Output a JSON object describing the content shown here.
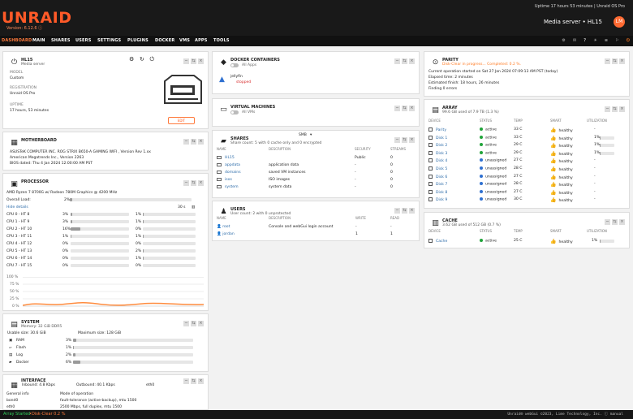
{
  "header": {
    "logo": "UNRAID",
    "version": "Version: 6.12.6 ⓘ",
    "uptime": "Uptime 17 hours 53 minutes  |  Unraid OS Pro",
    "server_title": "Media server  •  HL15",
    "avatar": "LM"
  },
  "nav": {
    "items": [
      "DASHBOARD",
      "MAIN",
      "SHARES",
      "USERS",
      "SETTINGS",
      "PLUGINS",
      "DOCKER",
      "VMS",
      "APPS",
      "TOOLS"
    ],
    "icons": [
      "⚙",
      "✉",
      "?",
      "☀",
      "≡",
      "⚐",
      "⏻"
    ]
  },
  "server": {
    "name": "HL15",
    "description": "Media server",
    "model_label": "MODEL",
    "model": "Custom",
    "registration_label": "REGISTRATION",
    "registration": "Unraid OS Pro",
    "uptime_label": "UPTIME",
    "uptime": "17 hours, 53 minutes",
    "edit_label": "EDIT"
  },
  "motherboard": {
    "title": "MOTHERBOARD",
    "line1": "ASUSTeK COMPUTER INC. ROG STRIX B650-A GAMING WIFI , Version Rev 1.xx",
    "line2": "American Megatrends Inc., Version 2263",
    "line3": "BIOS dated: Thu 4 Jan 2024 12:00:00 AM PST"
  },
  "processor": {
    "title": "PROCESSOR",
    "model": "AMD Ryzen 7 8700G w/ Radeon 780M Graphics @ 4200 MHz",
    "overall_label": "Overall Load:",
    "overall": "2%",
    "overall_value": 2,
    "hide": "Hide details",
    "interval": "30 s",
    "cpus": [
      {
        "name": "CPU 0 - HT 8",
        "a": "3%",
        "av": 3,
        "b": "1%",
        "bv": 1
      },
      {
        "name": "CPU 1 - HT 9",
        "a": "3%",
        "av": 3,
        "b": "1%",
        "bv": 1
      },
      {
        "name": "CPU 2 - HT 10",
        "a": "16%",
        "av": 16,
        "b": "0%",
        "bv": 0
      },
      {
        "name": "CPU 3 - HT 11",
        "a": "1%",
        "av": 1,
        "b": "1%",
        "bv": 1
      },
      {
        "name": "CPU 4 - HT 12",
        "a": "0%",
        "av": 0,
        "b": "0%",
        "bv": 0
      },
      {
        "name": "CPU 5 - HT 13",
        "a": "0%",
        "av": 0,
        "b": "2%",
        "bv": 2
      },
      {
        "name": "CPU 6 - HT 14",
        "a": "0%",
        "av": 0,
        "b": "1%",
        "bv": 1
      },
      {
        "name": "CPU 7 - HT 15",
        "a": "0%",
        "av": 0,
        "b": "0%",
        "bv": 0
      }
    ],
    "chart_labels": [
      "100 %",
      "75 %",
      "50 %",
      "25 %",
      "0 %"
    ]
  },
  "system": {
    "title": "SYSTEM",
    "memory": "Memory: 32 GiB DDR5",
    "usable": "Usable size: 30.6 GiB",
    "maximum": "Maximum size: 128 GiB",
    "items": [
      {
        "name": "RAM",
        "value": "3%",
        "pct": 3
      },
      {
        "name": "Flash",
        "value": "1%",
        "pct": 1
      },
      {
        "name": "Log",
        "value": "2%",
        "pct": 2
      },
      {
        "name": "Docker",
        "value": "6%",
        "pct": 6
      }
    ]
  },
  "interface": {
    "title": "INTERFACE",
    "inbound": "Inbound: 4.8 Kbps",
    "outbound": "Outbound: 40.1 Kbps",
    "port": "eth0",
    "general": "General info",
    "mode": "Mode of operation",
    "bond": "bond0",
    "bond_value": "fault-tolerance (active-backup), mtu 1500",
    "eth": "eth0",
    "eth_value": "2500 Mbps, full duplex, mtu 1500"
  },
  "docker": {
    "title": "DOCKER CONTAINERS",
    "sub": "All Apps",
    "name": "jellyfin",
    "state": "stopped"
  },
  "vms": {
    "title": "VIRTUAL MACHINES",
    "sub": "All VMs"
  },
  "shares": {
    "title": "SHARES",
    "smb": "SMB",
    "summary": "Share count: 5 with 0 cache only and 0 encrypted",
    "headers": [
      "NAME",
      "DESCRIPTION",
      "SECURITY",
      "STREAMS"
    ],
    "rows": [
      [
        "HL15",
        "",
        "Public",
        "0"
      ],
      [
        "appdata",
        "application data",
        "-",
        "0"
      ],
      [
        "domains",
        "saved VM instances",
        "-",
        "0"
      ],
      [
        "isos",
        "ISO images",
        "-",
        "0"
      ],
      [
        "system",
        "system data",
        "-",
        "0"
      ]
    ]
  },
  "users": {
    "title": "USERS",
    "summary": "User count: 2 with 0 unprotected",
    "headers": [
      "NAME",
      "DESCRIPTION",
      "WRITE",
      "READ"
    ],
    "rows": [
      [
        "root",
        "Console and webGui login account",
        "-",
        "-"
      ],
      [
        "jordan",
        "",
        "1",
        "1"
      ]
    ]
  },
  "parity": {
    "title": "PARITY",
    "status": "Disk-Clear in progress... Completed: 0.2 %.",
    "started": "Current operation started on Sat 27 Jan 2024 07:09:13 AM PST (today)",
    "elapsed": "Elapsed time: 2 minutes",
    "finish": "Estimated finish: 18 hours, 26 minutes",
    "errors": "Finding 0 errors"
  },
  "array": {
    "title": "ARRAY",
    "summary": "99.6 GB used of 7.9 TB (1.3 %)",
    "headers": [
      "DEVICE",
      "STATUS",
      "TEMP",
      "SMART",
      "UTILIZATION"
    ],
    "rows": [
      {
        "device": "Parity",
        "status": "active",
        "temp": "33 C",
        "smart": "healthy",
        "util": "-",
        "pct": 0,
        "color": "green"
      },
      {
        "device": "Disk 1",
        "status": "active",
        "temp": "33 C",
        "smart": "healthy",
        "util": "1%",
        "pct": 1,
        "color": "green"
      },
      {
        "device": "Disk 2",
        "status": "active",
        "temp": "29 C",
        "smart": "healthy",
        "util": "1%",
        "pct": 1,
        "color": "green"
      },
      {
        "device": "Disk 3",
        "status": "active",
        "temp": "29 C",
        "smart": "healthy",
        "util": "1%",
        "pct": 1,
        "color": "green"
      },
      {
        "device": "Disk 4",
        "status": "unassigned",
        "temp": "27 C",
        "smart": "healthy",
        "util": "-",
        "pct": 0,
        "color": "blue"
      },
      {
        "device": "Disk 5",
        "status": "unassigned",
        "temp": "28 C",
        "smart": "healthy",
        "util": "-",
        "pct": 0,
        "color": "blue"
      },
      {
        "device": "Disk 6",
        "status": "unassigned",
        "temp": "27 C",
        "smart": "healthy",
        "util": "-",
        "pct": 0,
        "color": "blue"
      },
      {
        "device": "Disk 7",
        "status": "unassigned",
        "temp": "28 C",
        "smart": "healthy",
        "util": "-",
        "pct": 0,
        "color": "blue"
      },
      {
        "device": "Disk 8",
        "status": "unassigned",
        "temp": "27 C",
        "smart": "healthy",
        "util": "-",
        "pct": 0,
        "color": "blue"
      },
      {
        "device": "Disk 9",
        "status": "unassigned",
        "temp": "30 C",
        "smart": "healthy",
        "util": "-",
        "pct": 0,
        "color": "blue"
      }
    ]
  },
  "cache": {
    "title": "CACHE",
    "summary": "3.62 GB used of 512 GB (0.7 %)",
    "headers": [
      "DEVICE",
      "STATUS",
      "TEMP",
      "SMART",
      "UTILIZATION"
    ],
    "row": {
      "device": "Cache",
      "status": "active",
      "temp": "25 C",
      "smart": "healthy",
      "util": "1%",
      "pct": 1
    }
  },
  "footer": {
    "array": "Array Started",
    "parity": "•Disk-Clear 0.2 %",
    "copyright": "Unraid® webGui ©2023, Lime Technology, Inc.  ⓘ manual"
  },
  "colors": {
    "accent": "#ff7a3c",
    "active": "#21a43a",
    "unassigned": "#2f70d0"
  }
}
